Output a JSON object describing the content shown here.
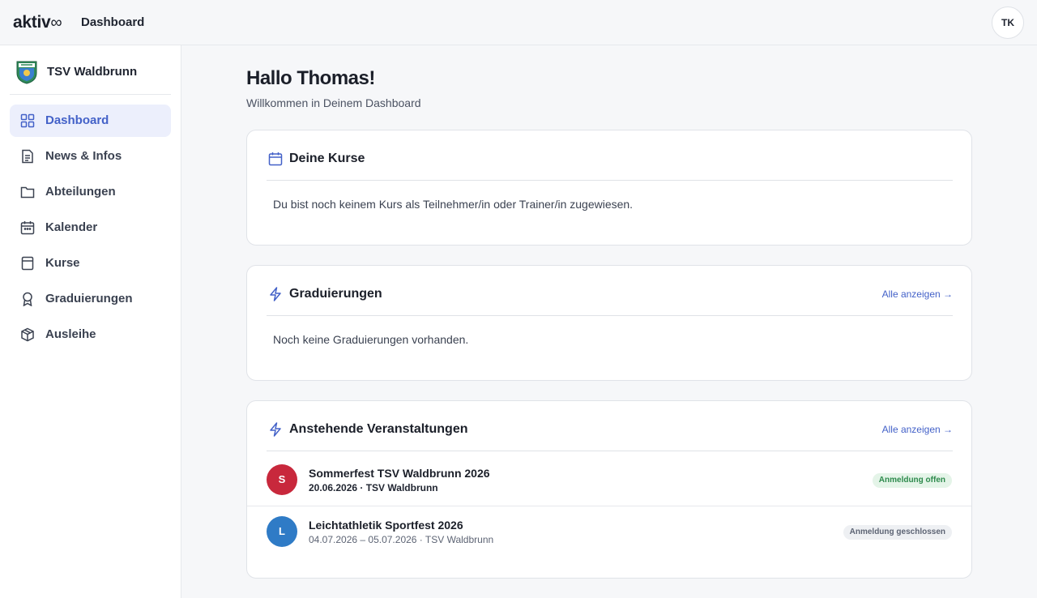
{
  "app": {
    "logo_text": "aktiv",
    "logo_symbol": "∞",
    "page_title": "Dashboard",
    "user_initials": "TK"
  },
  "sidebar": {
    "club_name": "TSV Waldbrunn",
    "items": [
      {
        "label": "Dashboard",
        "icon": "grid-icon",
        "active": true
      },
      {
        "label": "News & Infos",
        "icon": "document-icon",
        "active": false
      },
      {
        "label": "Abteilungen",
        "icon": "folder-icon",
        "active": false
      },
      {
        "label": "Kalender",
        "icon": "calendar-icon",
        "active": false
      },
      {
        "label": "Kurse",
        "icon": "book-icon",
        "active": false
      },
      {
        "label": "Graduierungen",
        "icon": "award-icon",
        "active": false
      },
      {
        "label": "Ausleihe",
        "icon": "box-icon",
        "active": false
      }
    ]
  },
  "main": {
    "greeting": "Hallo Thomas!",
    "subtitle": "Willkommen in Deinem Dashboard",
    "courses": {
      "title": "Deine Kurse",
      "empty_text": "Du bist noch keinem Kurs als Teilnehmer/in oder Trainer/in zugewiesen."
    },
    "graduations": {
      "title": "Graduierungen",
      "link": "Alle anzeigen →",
      "empty_text": "Noch keine Graduierungen vorhanden."
    },
    "events": {
      "title": "Anstehende Veranstaltungen",
      "link": "Alle anzeigen →",
      "items": [
        {
          "initial": "S",
          "title": "Sommerfest TSV Waldbrunn 2026",
          "meta": "20.06.2026 · TSV Waldbrunn",
          "badge": "Anmeldung offen",
          "color": "#c8283c"
        },
        {
          "initial": "L",
          "title": "Leichtathletik Sportfest 2026",
          "meta": "04.07.2026 – 05.07.2026 · TSV Waldbrunn",
          "badge": "Anmeldung geschlossen",
          "color": "#2f7bc6"
        }
      ]
    }
  },
  "colors": {
    "accent": "#4361c8",
    "active_nav_bg": "#eceffc",
    "badge_open_bg": "#e4f4e8",
    "badge_open_text": "#2d8a4c"
  }
}
